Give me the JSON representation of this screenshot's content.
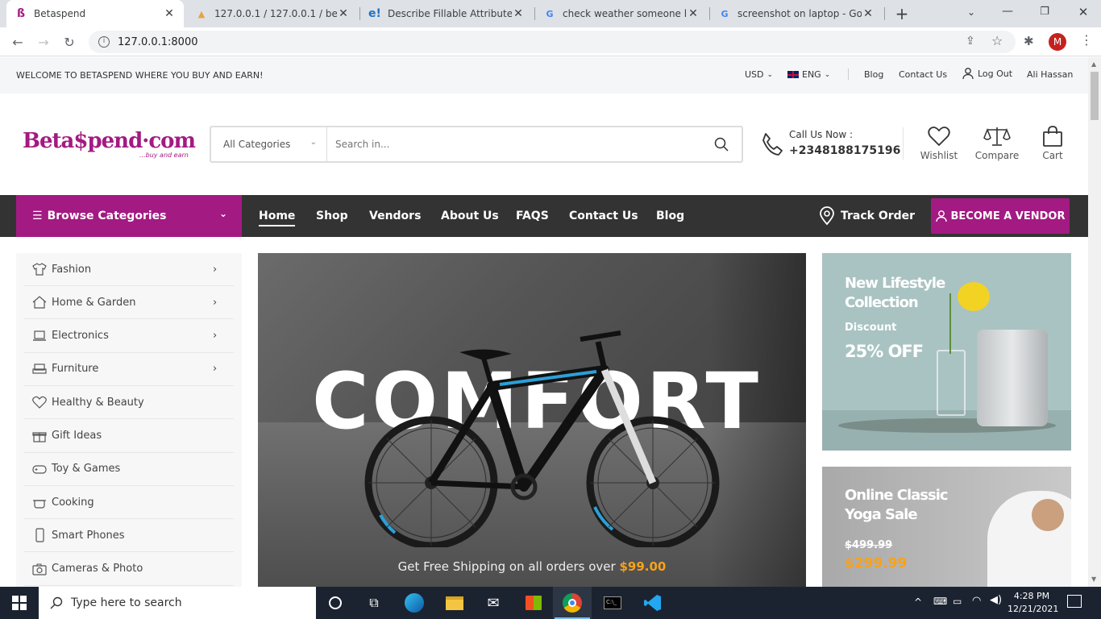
{
  "browser": {
    "tabs": [
      {
        "title": "Betaspend",
        "active": true
      },
      {
        "title": "127.0.0.1 / 127.0.0.1 / betasp",
        "active": false
      },
      {
        "title": "Describe Fillable Attribute in",
        "active": false
      },
      {
        "title": "check weather someone logg",
        "active": false
      },
      {
        "title": "screenshot on laptop - Goog",
        "active": false
      }
    ],
    "url": "127.0.0.1:8000",
    "profile_initial": "M"
  },
  "topbar": {
    "welcome": "WELCOME TO BETASPEND WHERE YOU BUY AND EARN!",
    "currency": "USD",
    "language": "ENG",
    "links": {
      "blog": "Blog",
      "contact": "Contact Us",
      "logout": "Log Out",
      "user": "Ali Hassan"
    }
  },
  "header": {
    "logo_text": "Beta$pend·com",
    "logo_tagline": "...buy and earn",
    "category_select": "All Categories",
    "search_placeholder": "Search in...",
    "call_label": "Call Us Now :",
    "phone": "+2348188175196",
    "actions": {
      "wishlist": "Wishlist",
      "compare": "Compare",
      "cart": "Cart"
    }
  },
  "nav": {
    "browse": "Browse Categories",
    "links": [
      "Home",
      "Shop",
      "Vendors",
      "About Us",
      "FAQS",
      "Contact Us",
      "Blog"
    ],
    "track_order": "Track Order",
    "become_vendor": "BECOME A VENDOR"
  },
  "sidebar": {
    "items": [
      {
        "label": "Fashion",
        "icon": "shirt-icon",
        "arrow": true
      },
      {
        "label": "Home & Garden",
        "icon": "home-icon",
        "arrow": true
      },
      {
        "label": "Electronics",
        "icon": "laptop-icon",
        "arrow": true
      },
      {
        "label": "Furniture",
        "icon": "sofa-icon",
        "arrow": true
      },
      {
        "label": "Healthy & Beauty",
        "icon": "heart-icon",
        "arrow": false
      },
      {
        "label": "Gift Ideas",
        "icon": "gift-icon",
        "arrow": false
      },
      {
        "label": "Toy & Games",
        "icon": "gamepad-icon",
        "arrow": false
      },
      {
        "label": "Cooking",
        "icon": "pot-icon",
        "arrow": false
      },
      {
        "label": "Smart Phones",
        "icon": "phone-icon",
        "arrow": false
      },
      {
        "label": "Cameras & Photo",
        "icon": "camera-icon",
        "arrow": false
      }
    ]
  },
  "hero": {
    "headline": "COMFORT",
    "shipping_text": "Get Free Shipping on all orders over",
    "shipping_amount": "$99.00"
  },
  "promo1": {
    "title_line1": "New Lifestyle",
    "title_line2": "Collection",
    "discount_label": "Discount",
    "discount": "25% OFF"
  },
  "promo2": {
    "title_line1": "Online Classic",
    "title_line2": "Yoga Sale",
    "old_price": "$499.99",
    "new_price": "$299.99"
  },
  "taskbar": {
    "search_placeholder": "Type here to search",
    "time": "4:28 PM",
    "date": "12/21/2021"
  },
  "colors": {
    "brand": "#a31a82",
    "accent": "#f7a21b",
    "nav_bg": "#333333"
  }
}
